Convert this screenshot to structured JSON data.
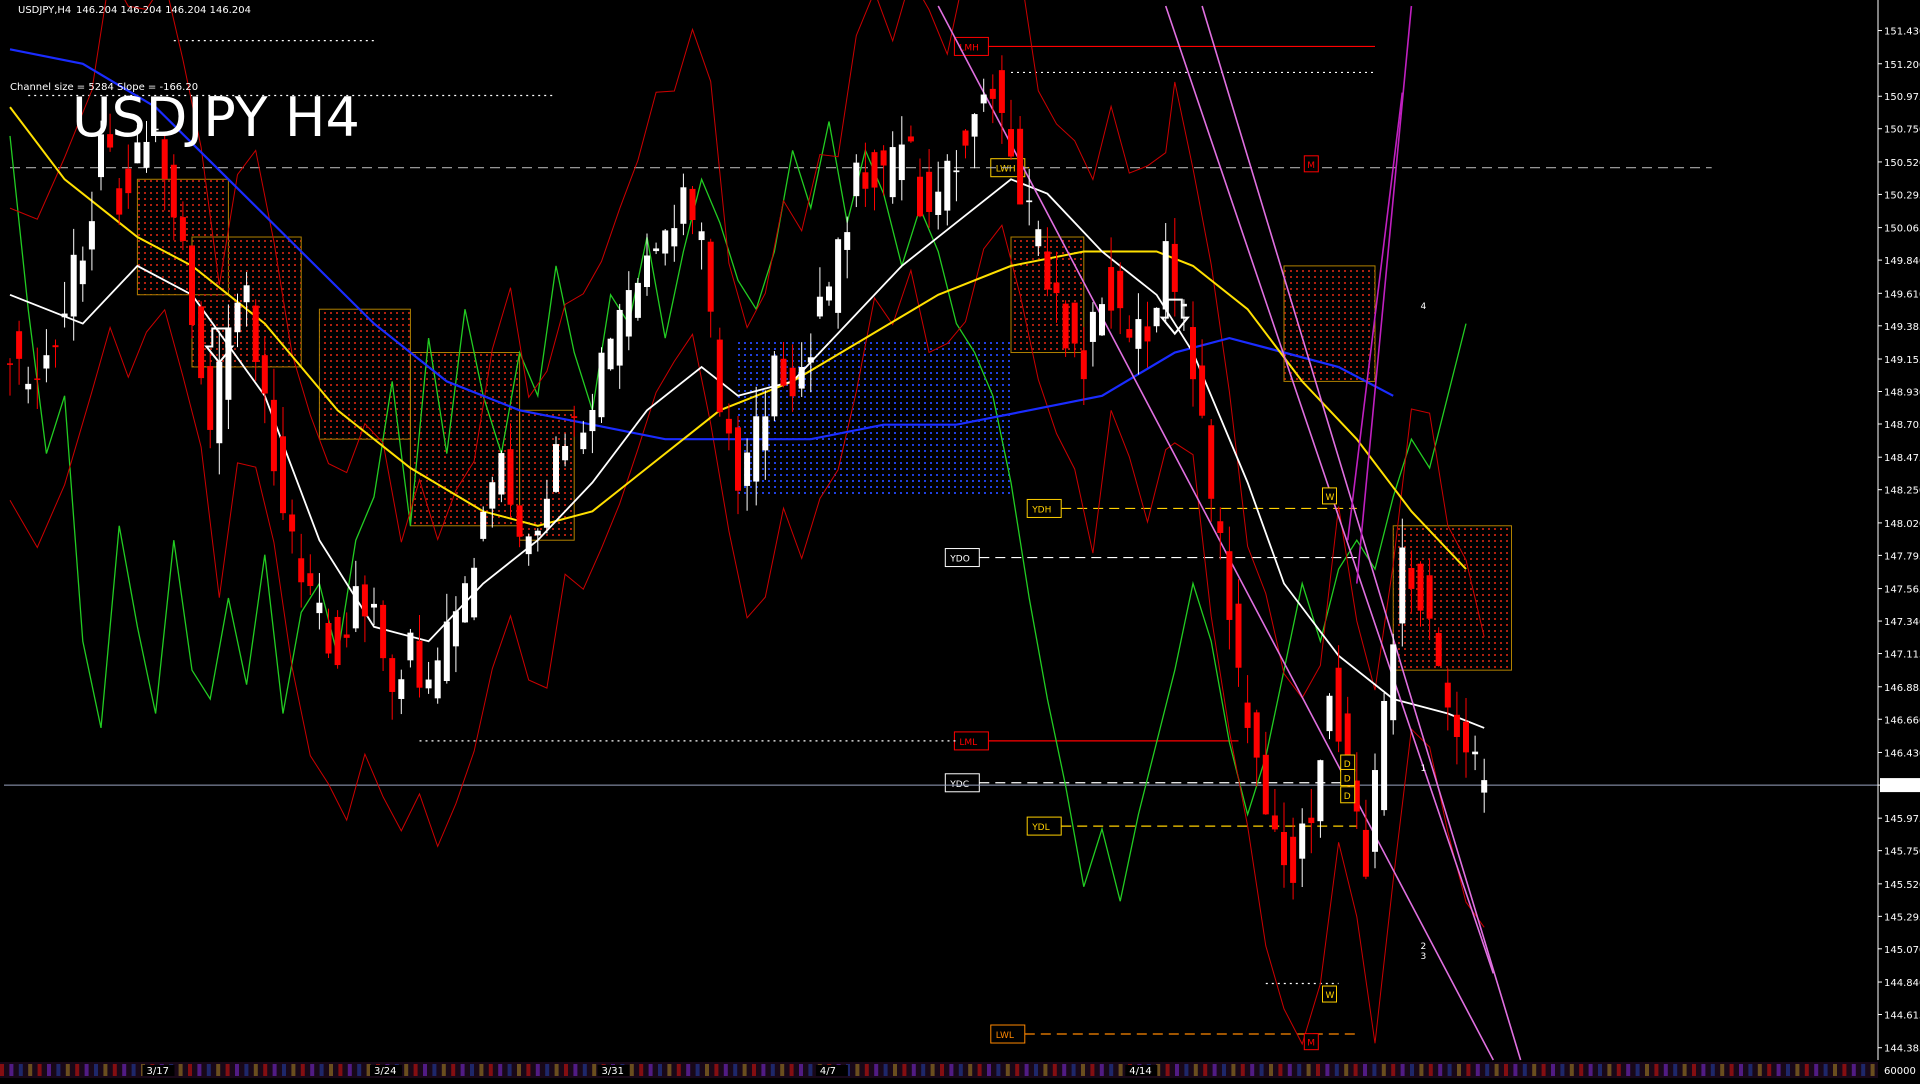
{
  "header": {
    "symbol_info": "USDJPY,H4",
    "ohlc": "146.204 146.204 146.204 146.204",
    "channel_info": "Channel size = 5284 Slope = -166.20",
    "big_title": "USDJPY H4"
  },
  "colors": {
    "background": "#000000",
    "bull_candle": "#ffffff",
    "bear_candle": "#ff0000",
    "ma_fast": "#ffffff",
    "ma_mid": "#ffe000",
    "ma_slow": "#1a2cff",
    "oscillator": "#22cc22",
    "envelope": "#cc0000",
    "cloud": "#b02010",
    "channel": "#e070e0",
    "level_yellow": "#ffd000",
    "price_tag_bg": "#ffffff"
  },
  "chart_data": {
    "type": "candlestick",
    "title": "USDJPY H4",
    "ylim": [
      144.3,
      151.6
    ],
    "y_ticks": [
      "151.430",
      "151.200",
      "150.975",
      "150.750",
      "150.520",
      "150.295",
      "150.065",
      "149.840",
      "149.610",
      "149.385",
      "149.155",
      "148.930",
      "148.705",
      "148.475",
      "148.250",
      "148.020",
      "147.795",
      "147.565",
      "147.340",
      "147.115",
      "146.885",
      "146.660",
      "146.430",
      "146.204",
      "145.975",
      "145.750",
      "145.520",
      "145.295",
      "145.070",
      "144.840",
      "144.615",
      "144.385"
    ],
    "current_price": 146.204,
    "current_price_label": "146.204",
    "x_ticks": [
      {
        "label": "3/17",
        "index": 15
      },
      {
        "label": "3/24",
        "index": 40
      },
      {
        "label": "3/31",
        "index": 65
      },
      {
        "label": "4/7",
        "index": 89
      },
      {
        "label": "4/14",
        "index": 123
      }
    ],
    "oscillator_scale_label": "60000",
    "candles_count": 150,
    "anchors": [
      [
        0,
        149.3
      ],
      [
        3,
        149.0
      ],
      [
        6,
        149.4
      ],
      [
        9,
        149.9
      ],
      [
        11,
        150.6
      ],
      [
        13,
        150.3
      ],
      [
        15,
        150.5
      ],
      [
        17,
        150.7
      ],
      [
        19,
        150.2
      ],
      [
        21,
        149.5
      ],
      [
        23,
        148.6
      ],
      [
        25,
        149.4
      ],
      [
        27,
        149.7
      ],
      [
        29,
        148.9
      ],
      [
        31,
        148.0
      ],
      [
        33,
        147.7
      ],
      [
        35,
        147.3
      ],
      [
        37,
        147.1
      ],
      [
        39,
        147.5
      ],
      [
        41,
        147.3
      ],
      [
        43,
        146.9
      ],
      [
        45,
        147.1
      ],
      [
        47,
        146.8
      ],
      [
        49,
        147.3
      ],
      [
        51,
        147.5
      ],
      [
        53,
        148.1
      ],
      [
        55,
        148.4
      ],
      [
        57,
        147.9
      ],
      [
        59,
        148.1
      ],
      [
        61,
        148.6
      ],
      [
        63,
        148.7
      ],
      [
        65,
        148.9
      ],
      [
        67,
        149.2
      ],
      [
        69,
        149.5
      ],
      [
        71,
        149.9
      ],
      [
        73,
        150.1
      ],
      [
        75,
        150.3
      ],
      [
        77,
        149.9
      ],
      [
        79,
        148.9
      ],
      [
        81,
        148.3
      ],
      [
        83,
        148.6
      ],
      [
        85,
        149.2
      ],
      [
        87,
        149.0
      ],
      [
        89,
        149.3
      ],
      [
        91,
        149.6
      ],
      [
        93,
        150.2
      ],
      [
        95,
        150.5
      ],
      [
        97,
        150.4
      ],
      [
        99,
        150.7
      ],
      [
        101,
        150.3
      ],
      [
        103,
        150.3
      ],
      [
        105,
        150.6
      ],
      [
        107,
        150.9
      ],
      [
        109,
        151.0
      ],
      [
        111,
        150.7
      ],
      [
        113,
        150.1
      ],
      [
        115,
        149.7
      ],
      [
        117,
        149.4
      ],
      [
        119,
        149.1
      ],
      [
        121,
        149.7
      ],
      [
        123,
        149.5
      ],
      [
        125,
        149.3
      ],
      [
        127,
        149.6
      ],
      [
        128,
        149.8
      ],
      [
        130,
        149.4
      ],
      [
        132,
        148.6
      ],
      [
        134,
        147.8
      ],
      [
        136,
        146.9
      ],
      [
        138,
        146.3
      ],
      [
        140,
        145.9
      ],
      [
        142,
        145.6
      ],
      [
        144,
        146.1
      ],
      [
        146,
        146.9
      ],
      [
        148,
        146.2
      ],
      [
        150,
        145.6
      ],
      [
        152,
        146.8
      ],
      [
        154,
        147.7
      ],
      [
        156,
        147.5
      ],
      [
        158,
        147.0
      ],
      [
        160,
        146.5
      ],
      [
        162,
        146.3
      ]
    ],
    "ma_fast_points": [
      [
        0,
        149.6
      ],
      [
        8,
        149.4
      ],
      [
        14,
        149.8
      ],
      [
        20,
        149.6
      ],
      [
        28,
        148.9
      ],
      [
        34,
        147.9
      ],
      [
        40,
        147.3
      ],
      [
        46,
        147.2
      ],
      [
        52,
        147.6
      ],
      [
        58,
        147.9
      ],
      [
        64,
        148.3
      ],
      [
        70,
        148.8
      ],
      [
        76,
        149.1
      ],
      [
        80,
        148.9
      ],
      [
        86,
        149.0
      ],
      [
        92,
        149.4
      ],
      [
        98,
        149.8
      ],
      [
        104,
        150.1
      ],
      [
        110,
        150.4
      ],
      [
        114,
        150.3
      ],
      [
        120,
        149.9
      ],
      [
        126,
        149.6
      ],
      [
        130,
        149.2
      ],
      [
        136,
        148.3
      ],
      [
        140,
        147.6
      ],
      [
        146,
        147.1
      ],
      [
        152,
        146.8
      ],
      [
        158,
        146.7
      ],
      [
        162,
        146.6
      ]
    ],
    "ma_mid_points": [
      [
        0,
        150.9
      ],
      [
        6,
        150.4
      ],
      [
        14,
        150.0
      ],
      [
        20,
        149.8
      ],
      [
        28,
        149.4
      ],
      [
        36,
        148.8
      ],
      [
        44,
        148.4
      ],
      [
        52,
        148.1
      ],
      [
        58,
        148.0
      ],
      [
        64,
        148.1
      ],
      [
        70,
        148.4
      ],
      [
        78,
        148.8
      ],
      [
        86,
        149.0
      ],
      [
        94,
        149.3
      ],
      [
        102,
        149.6
      ],
      [
        110,
        149.8
      ],
      [
        118,
        149.9
      ],
      [
        126,
        149.9
      ],
      [
        130,
        149.8
      ],
      [
        136,
        149.5
      ],
      [
        142,
        149.0
      ],
      [
        148,
        148.6
      ],
      [
        154,
        148.1
      ],
      [
        160,
        147.7
      ]
    ],
    "ma_slow_points": [
      [
        0,
        151.3
      ],
      [
        8,
        151.2
      ],
      [
        16,
        150.9
      ],
      [
        24,
        150.4
      ],
      [
        32,
        149.9
      ],
      [
        40,
        149.4
      ],
      [
        48,
        149.0
      ],
      [
        56,
        148.8
      ],
      [
        64,
        148.7
      ],
      [
        72,
        148.6
      ],
      [
        80,
        148.6
      ],
      [
        88,
        148.6
      ],
      [
        96,
        148.7
      ],
      [
        104,
        148.7
      ],
      [
        112,
        148.8
      ],
      [
        120,
        148.9
      ],
      [
        128,
        149.2
      ],
      [
        134,
        149.3
      ],
      [
        140,
        149.2
      ],
      [
        146,
        149.1
      ],
      [
        152,
        148.9
      ]
    ],
    "osc_points": [
      [
        0,
        150.7
      ],
      [
        2,
        149.5
      ],
      [
        4,
        148.5
      ],
      [
        6,
        148.9
      ],
      [
        8,
        147.2
      ],
      [
        10,
        146.6
      ],
      [
        12,
        148.0
      ],
      [
        14,
        147.3
      ],
      [
        16,
        146.7
      ],
      [
        18,
        147.9
      ],
      [
        20,
        147.0
      ],
      [
        22,
        146.8
      ],
      [
        24,
        147.5
      ],
      [
        26,
        146.9
      ],
      [
        28,
        147.8
      ],
      [
        30,
        146.7
      ],
      [
        32,
        147.4
      ],
      [
        34,
        147.6
      ],
      [
        36,
        147.1
      ],
      [
        38,
        147.9
      ],
      [
        40,
        148.2
      ],
      [
        42,
        149.0
      ],
      [
        44,
        148.0
      ],
      [
        46,
        149.3
      ],
      [
        48,
        148.5
      ],
      [
        50,
        149.5
      ],
      [
        52,
        148.9
      ],
      [
        54,
        148.5
      ],
      [
        56,
        149.2
      ],
      [
        58,
        148.9
      ],
      [
        60,
        149.8
      ],
      [
        62,
        149.2
      ],
      [
        64,
        148.8
      ],
      [
        66,
        149.6
      ],
      [
        68,
        149.4
      ],
      [
        70,
        150.0
      ],
      [
        72,
        149.3
      ],
      [
        74,
        149.9
      ],
      [
        76,
        150.4
      ],
      [
        78,
        150.1
      ],
      [
        80,
        149.7
      ],
      [
        82,
        149.5
      ],
      [
        84,
        149.9
      ],
      [
        86,
        150.6
      ],
      [
        88,
        150.2
      ],
      [
        90,
        150.8
      ],
      [
        92,
        150.1
      ],
      [
        94,
        150.6
      ],
      [
        96,
        150.3
      ],
      [
        98,
        149.8
      ],
      [
        100,
        150.2
      ],
      [
        102,
        149.9
      ],
      [
        104,
        149.4
      ],
      [
        106,
        149.2
      ],
      [
        108,
        148.9
      ],
      [
        110,
        148.3
      ],
      [
        112,
        147.5
      ],
      [
        114,
        146.8
      ],
      [
        116,
        146.2
      ],
      [
        118,
        145.5
      ],
      [
        120,
        145.9
      ],
      [
        122,
        145.4
      ],
      [
        124,
        146.0
      ],
      [
        126,
        146.5
      ],
      [
        128,
        147.0
      ],
      [
        130,
        147.6
      ],
      [
        132,
        147.2
      ],
      [
        134,
        146.5
      ],
      [
        136,
        146.0
      ],
      [
        138,
        146.4
      ],
      [
        140,
        147.0
      ],
      [
        142,
        147.6
      ],
      [
        144,
        147.2
      ],
      [
        146,
        147.7
      ],
      [
        148,
        147.9
      ],
      [
        150,
        147.7
      ],
      [
        152,
        148.2
      ],
      [
        154,
        148.6
      ],
      [
        156,
        148.4
      ],
      [
        158,
        148.9
      ],
      [
        160,
        149.4
      ]
    ],
    "cloud_spans": [
      {
        "from": 14,
        "to": 24,
        "top": 150.4,
        "bot": 149.6
      },
      {
        "from": 20,
        "to": 32,
        "top": 150.0,
        "bot": 149.1
      },
      {
        "from": 34,
        "to": 44,
        "top": 149.5,
        "bot": 148.6
      },
      {
        "from": 44,
        "to": 56,
        "top": 149.2,
        "bot": 148.0
      },
      {
        "from": 56,
        "to": 62,
        "top": 148.8,
        "bot": 147.9
      },
      {
        "from": 110,
        "to": 118,
        "top": 150.0,
        "bot": 149.2
      },
      {
        "from": 140,
        "to": 150,
        "top": 149.8,
        "bot": 149.0
      },
      {
        "from": 152,
        "to": 165,
        "top": 148.0,
        "bot": 147.0
      }
    ],
    "blue_cloud_spans": [
      {
        "from": 80,
        "to": 110,
        "top": 149.3,
        "bot": 148.2
      }
    ],
    "channel_lines": [
      {
        "x1": 102,
        "y1": 151.6,
        "x2": 163,
        "y2": 144.3
      },
      {
        "x1": 127,
        "y1": 151.6,
        "x2": 163,
        "y2": 144.9
      },
      {
        "x1": 131,
        "y1": 151.6,
        "x2": 166,
        "y2": 144.3
      }
    ],
    "parabola_lines": [
      {
        "x1": 148,
        "y1": 147.6,
        "x2": 154,
        "y2": 151.6
      },
      {
        "x1": 147,
        "y1": 147.9,
        "x2": 153,
        "y2": 151.0
      }
    ],
    "levels": [
      {
        "name": "LMH",
        "label": "LMH",
        "value": 151.32,
        "from": 104,
        "to": 150,
        "color": "#ff0000",
        "style": "solid"
      },
      {
        "name": "top-dotted",
        "label": "",
        "value": 151.36,
        "from": 18,
        "to": 40,
        "color": "#ffffff",
        "style": "dotted"
      },
      {
        "name": "r-dotted-1",
        "label": "",
        "value": 151.14,
        "from": 110,
        "to": 150,
        "color": "#ffffff",
        "style": "dotted"
      },
      {
        "name": "r-dotted-2",
        "label": "",
        "value": 150.98,
        "from": 2,
        "to": 60,
        "color": "#ffffff",
        "style": "dotted"
      },
      {
        "name": "LWH",
        "label": "LWH",
        "value": 150.48,
        "from": 108,
        "to": 112,
        "color": "#ffd000",
        "style": "solid"
      },
      {
        "name": "M-upper",
        "label": "M",
        "value": 150.48,
        "from": 0,
        "to": 187,
        "color": "#aaaaaa",
        "style": "dashed"
      },
      {
        "name": "YDH",
        "label": "YDH",
        "value": 148.12,
        "from": 112,
        "to": 148,
        "color": "#ffd000",
        "style": "dashed"
      },
      {
        "name": "YDO",
        "label": "YDO",
        "value": 147.78,
        "from": 103,
        "to": 148,
        "color": "#ffffff",
        "style": "dashed"
      },
      {
        "name": "LML",
        "label": "LML",
        "value": 146.51,
        "from": 104,
        "to": 135,
        "color": "#ff0000",
        "style": "solid"
      },
      {
        "name": "low-dotted",
        "label": "",
        "value": 146.51,
        "from": 45,
        "to": 104,
        "color": "#ffffff",
        "style": "dotted"
      },
      {
        "name": "YDC",
        "label": "YDC",
        "value": 146.22,
        "from": 103,
        "to": 148,
        "color": "#ffffff",
        "style": "dashed"
      },
      {
        "name": "YDL",
        "label": "YDL",
        "value": 145.92,
        "from": 112,
        "to": 148,
        "color": "#ffd000",
        "style": "dashed"
      },
      {
        "name": "LWL",
        "label": "LWL",
        "value": 144.48,
        "from": 108,
        "to": 148,
        "color": "#ff8800",
        "style": "dashed"
      },
      {
        "name": "low-white-dotted",
        "label": "",
        "value": 144.83,
        "from": 138,
        "to": 146,
        "color": "#ffffff",
        "style": "dotted"
      }
    ],
    "markers": [
      {
        "label": "M",
        "name": "marker-m-top",
        "value": 150.5,
        "index": 143,
        "color": "#ff0000"
      },
      {
        "label": "W",
        "name": "marker-w-top",
        "value": 148.2,
        "index": 145,
        "color": "#ffd000"
      },
      {
        "label": "W",
        "name": "marker-w-bottom",
        "value": 144.75,
        "index": 145,
        "color": "#ffd000"
      },
      {
        "label": "M",
        "name": "marker-m-bottom",
        "value": 144.42,
        "index": 143,
        "color": "#ff0000"
      },
      {
        "label": "D",
        "name": "marker-d-1",
        "value": 146.35,
        "index": 147,
        "color": "#ffd000"
      },
      {
        "label": "D",
        "name": "marker-d-2",
        "value": 146.25,
        "index": 147,
        "color": "#ffd000"
      },
      {
        "label": "D",
        "name": "marker-d-3",
        "value": 146.13,
        "index": 147,
        "color": "#ffd000"
      }
    ],
    "projection_labels": [
      {
        "label": "4",
        "index": 155,
        "value": 149.5
      },
      {
        "label": "1",
        "index": 155,
        "value": 146.3
      },
      {
        "label": "2",
        "index": 155,
        "value": 145.07
      },
      {
        "label": "3",
        "index": 155,
        "value": 145.0
      }
    ],
    "down_arrows": [
      {
        "index": 23,
        "value": 149.2
      },
      {
        "index": 128,
        "value": 149.4
      }
    ]
  }
}
